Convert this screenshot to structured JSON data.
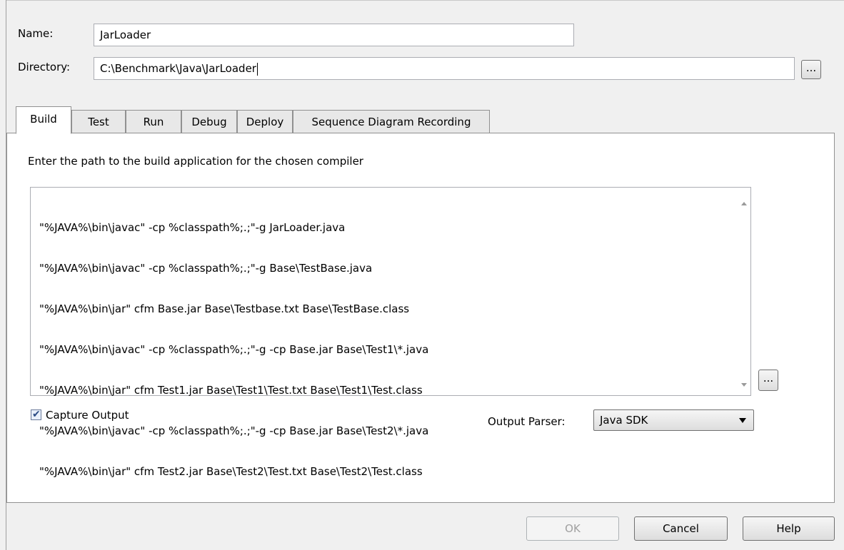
{
  "form": {
    "name_label": "Name:",
    "name_value": "JarLoader",
    "directory_label": "Directory:",
    "directory_value": "C:\\Benchmark\\Java\\JarLoader",
    "browse_label": "..."
  },
  "tabs": [
    {
      "label": "Build",
      "active": true
    },
    {
      "label": "Test",
      "active": false
    },
    {
      "label": "Run",
      "active": false
    },
    {
      "label": "Debug",
      "active": false
    },
    {
      "label": "Deploy",
      "active": false
    },
    {
      "label": "Sequence Diagram Recording",
      "active": false
    }
  ],
  "build": {
    "instruction": "Enter the path to the build application for the chosen compiler",
    "script_lines": [
      "\"%JAVA%\\bin\\javac\" -cp %classpath%;.;\"-g JarLoader.java",
      "\"%JAVA%\\bin\\javac\" -cp %classpath%;.;\"-g Base\\TestBase.java",
      "\"%JAVA%\\bin\\jar\" cfm Base.jar Base\\Testbase.txt Base\\TestBase.class",
      "\"%JAVA%\\bin\\javac\" -cp %classpath%;.;\"-g -cp Base.jar Base\\Test1\\*.java",
      "\"%JAVA%\\bin\\jar\" cfm Test1.jar Base\\Test1\\Test.txt Base\\Test1\\Test.class",
      "\"%JAVA%\\bin\\javac\" -cp %classpath%;.;\"-g -cp Base.jar Base\\Test2\\*.java",
      "\"%JAVA%\\bin\\jar\" cfm Test2.jar Base\\Test2\\Test.txt Base\\Test2\\Test.class"
    ],
    "browse_label": "...",
    "capture_output_label": "Capture Output",
    "capture_output_checked": true,
    "output_parser_label": "Output Parser:",
    "output_parser_value": "Java SDK"
  },
  "footer": {
    "ok_label": "OK",
    "cancel_label": "Cancel",
    "help_label": "Help"
  }
}
